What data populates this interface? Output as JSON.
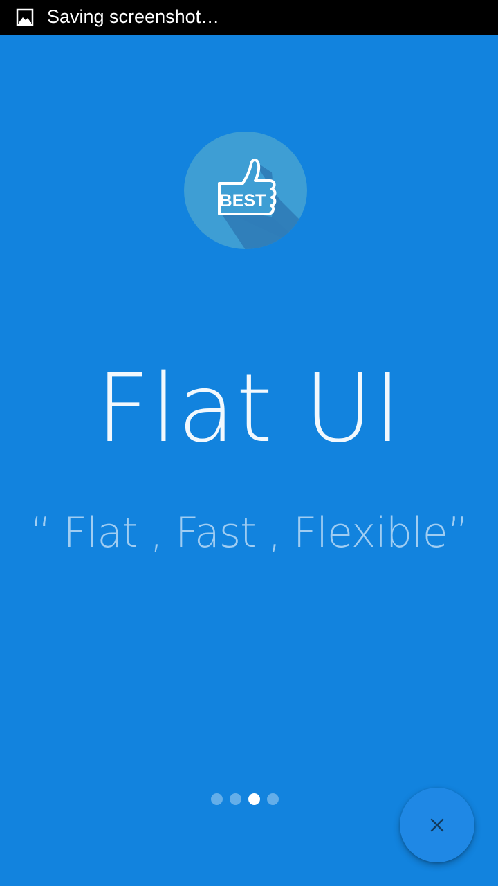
{
  "status_bar": {
    "notification_text": "Saving screenshot…",
    "notification_icon": "image-icon"
  },
  "badge": {
    "icon": "thumbs-up-best-icon",
    "label": "BEST"
  },
  "headline": "Flat UI",
  "tagline": "“ Flat , Fast , Flexible”",
  "pager": {
    "page_count": 4,
    "current_page": 3
  },
  "fab": {
    "icon": "close-icon"
  },
  "colors": {
    "background": "#1283de",
    "badge_circle": "#3e9ed4",
    "badge_shadow": "#2f7db8",
    "fab": "#1f88e5"
  }
}
